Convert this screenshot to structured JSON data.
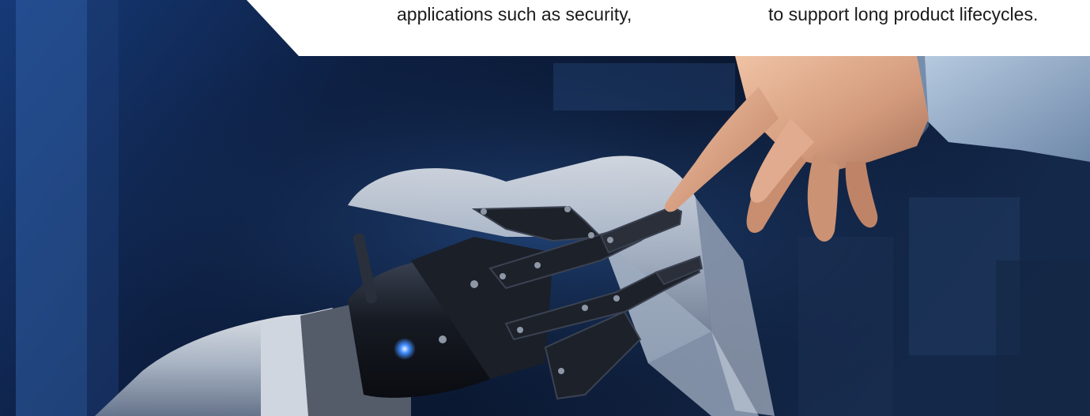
{
  "feature_text": {
    "left_column_line": "applications such as security,",
    "right_column_line": "to support long product lifecycles."
  },
  "hero_image": {
    "description_icon": "robotic-gripper-touching-hand-photo",
    "palette": {
      "background_dark": "#0b1428",
      "background_blue": "#1c3f7d",
      "robot_white": "#d7dde6",
      "metal_dark": "#1a1d24",
      "skin": "#d9a488",
      "shirt": "#8fa7c4",
      "led": "#3f8cff"
    }
  }
}
